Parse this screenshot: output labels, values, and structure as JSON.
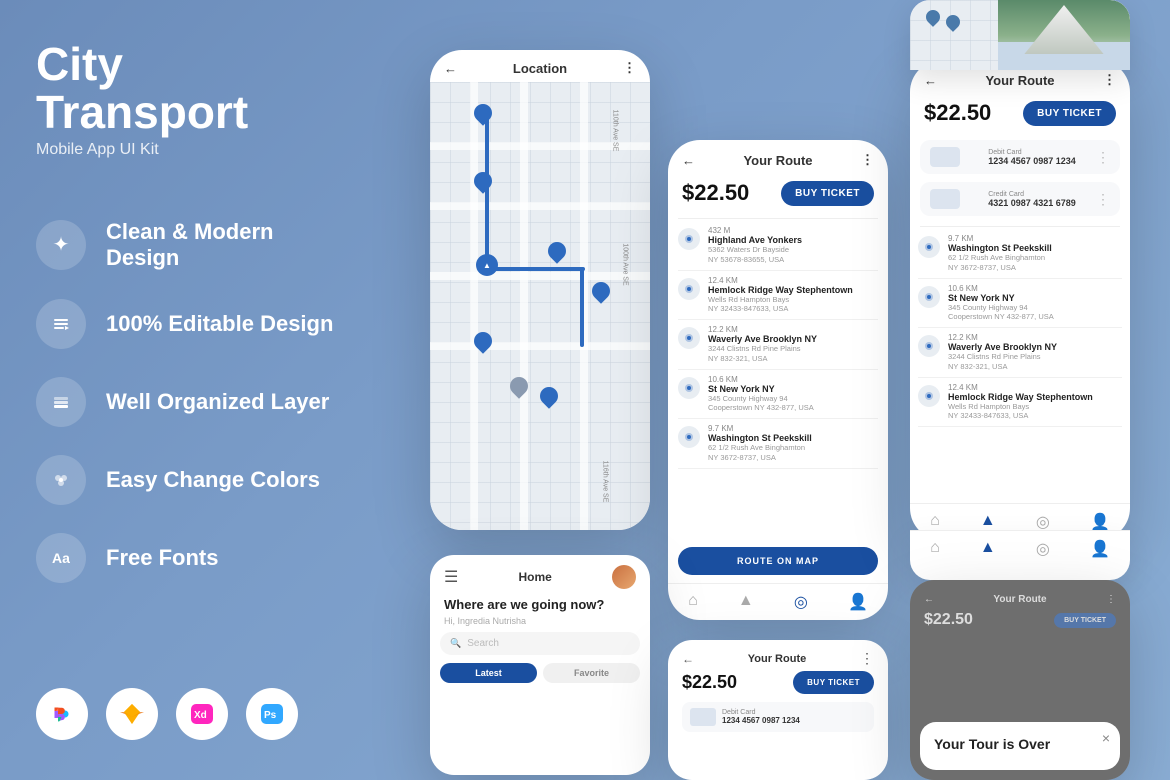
{
  "brand": {
    "title": "City Transport",
    "subtitle": "Mobile App UI Kit"
  },
  "features": [
    {
      "id": "clean-design",
      "label": "Clean & Modern Design",
      "icon": "✦"
    },
    {
      "id": "editable",
      "label": "100% Editable Design",
      "icon": "⬡"
    },
    {
      "id": "layers",
      "label": "Well Organized Layer",
      "icon": "⊞"
    },
    {
      "id": "colors",
      "label": "Easy Change Colors",
      "icon": "⬢"
    },
    {
      "id": "fonts",
      "label": "Free Fonts",
      "icon": "Aa"
    }
  ],
  "tools": [
    {
      "id": "figma",
      "label": "F",
      "color": "#fff"
    },
    {
      "id": "sketch",
      "label": "S",
      "color": "#fff"
    },
    {
      "id": "xd",
      "label": "Xd",
      "color": "#fff"
    },
    {
      "id": "ps",
      "label": "Ps",
      "color": "#fff"
    }
  ],
  "map_screen": {
    "title": "Location",
    "back": "←",
    "menu": "⋮"
  },
  "route_screen": {
    "title": "Your Route",
    "back": "←",
    "menu": "⋮",
    "price": "$22.50",
    "buy_btn": "BUY TICKET",
    "route_map_btn": "ROUTE ON MAP",
    "stops": [
      {
        "km": "432 M",
        "name": "Highland Ave Yonkers",
        "addr": "5362 Waters Dr Bayside\nNY 53678-83655, USA"
      },
      {
        "km": "12.4 KM",
        "name": "Hemlock Ridge Way Stephentown",
        "addr": "Wells Rd Hampton Bays\nNY 32433-847633, USA"
      },
      {
        "km": "12.2 KM",
        "name": "Waverly Ave Brooklyn NY",
        "addr": "3244 Clistns Rd Pine Plains\nNY 832-321, USA"
      },
      {
        "km": "10.6 KM",
        "name": "St New York NY",
        "addr": "345 County Highway 94\nCooperstown NY 432-877, USA"
      },
      {
        "km": "9.7 KM",
        "name": "Washington St Peekskill",
        "addr": "62 1/2 Rush Ave Binghamton\nNY 3672-8737, USA"
      }
    ]
  },
  "route_right_screen": {
    "title": "Your Route",
    "back": "←",
    "menu": "⋮",
    "price": "$22.50",
    "buy_btn": "BUY TICKET",
    "cards": [
      {
        "type": "Debit Card",
        "num": "1234 4567 0987 1234"
      },
      {
        "type": "Credit Card",
        "num": "4321 0987 4321 6789"
      }
    ],
    "stops": [
      {
        "km": "9.7 KM",
        "name": "Washington St Peekskill",
        "addr": "62 1/2 Rush Ave Binghamton\nNY 3672-8737, USA"
      },
      {
        "km": "10.6 KM",
        "name": "St New York NY",
        "addr": "345 County Highway 94\nCooperstown NY 432-877, USA"
      },
      {
        "km": "12.2 KM",
        "name": "Waverly Ave Brooklyn NY",
        "addr": "3244 Clistns Rd Pine Plains\nNY 832-321, USA"
      },
      {
        "km": "12.4 KM",
        "name": "Hemlock Ridge Way Stephentown",
        "addr": "Wells Rd Hampton Bays\nNY 32433-847633, USA"
      }
    ]
  },
  "home_screen": {
    "title": "Home",
    "greeting": "Where are we going now?",
    "subname": "Hi, Ingredia Nutrisha",
    "search_placeholder": "Search",
    "tabs": [
      "Latest",
      "Favorite"
    ]
  },
  "route_bottom_screen": {
    "title": "Your Route",
    "back": "←",
    "menu": "⋮",
    "price": "$22.50",
    "buy_btn": "BUY TICKET",
    "card_type": "Debit Card",
    "card_num": "1234 4567 0987 1234"
  },
  "tour_over": {
    "title": "Your Tour is Over",
    "close": "×"
  }
}
